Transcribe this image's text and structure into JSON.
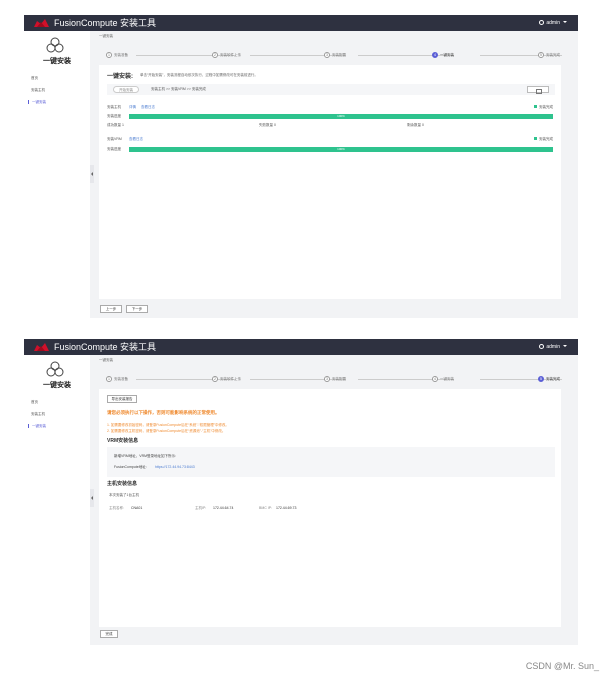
{
  "app": {
    "title": "FusionCompute 安装工具",
    "user": "admin"
  },
  "sidebar": {
    "title": "一键安装",
    "items": [
      {
        "label": "首页"
      },
      {
        "label": "安装主机"
      },
      {
        "label": "一键安装"
      }
    ]
  },
  "breadcrumb": "一键安装",
  "screen1": {
    "steps": [
      {
        "num": "1",
        "label": "安装准备"
      },
      {
        "num": "2",
        "label": "安装软件上传"
      },
      {
        "num": "3",
        "label": "安装配置"
      },
      {
        "num": "4",
        "label": "一键安装"
      },
      {
        "num": "5",
        "label": "安装完成"
      }
    ],
    "current_step": 3,
    "intro": {
      "title": "一键安装:",
      "description": "单击“开始安装”，安装流程自动依次执行，过程中如需修改可在安装前进行。"
    },
    "flow": {
      "tag": "开始安装",
      "text": "安装主机 >> 安装VRM >> 安装完成"
    },
    "host_section": {
      "label": "安装主机",
      "links": [
        "详情",
        "查看日志"
      ],
      "status": "安装完成",
      "progress_label": "安装进度",
      "progress": 100,
      "progress_text": "100%",
      "counts": [
        "成功数量 1",
        "失败数量 0",
        "剩余数量 0"
      ]
    },
    "vrm_section": {
      "label": "安装VRM",
      "links": [
        "查看日志"
      ],
      "status": "安装完成",
      "progress_label": "安装进度",
      "progress": 100,
      "progress_text": "100%"
    },
    "buttons": {
      "prev": "上一步",
      "next": "下一步"
    }
  },
  "screen2": {
    "steps": [
      {
        "num": "1",
        "label": "安装准备"
      },
      {
        "num": "2",
        "label": "安装软件上传"
      },
      {
        "num": "3",
        "label": "安装配置"
      },
      {
        "num": "4",
        "label": "一键安装"
      },
      {
        "num": "5",
        "label": "安装完成"
      }
    ],
    "current_step": 4,
    "export_button": "导出安装报告",
    "warning": {
      "title": "请您必须执行以下操作，否则可能影响系统的正常使用。",
      "lines": [
        "1. 如需要修改初始密码，请登录FusionCompute后在“系统”-“权限管理”中修改。",
        "2. 如需要修改主机密码，请登录FusionCompute后在“资源池”-“主机”中修改。"
      ]
    },
    "vrm_info": {
      "title": "VRM安装信息",
      "line1": "新增VRM地址，VRM登录地址如下所示:",
      "url_label": "FusionCompute地址:",
      "url": "https://172.44.94.73:8443"
    },
    "host_info": {
      "title": "主机安装信息",
      "line": "本次安装了1台主机",
      "row": [
        {
          "label": "主机名称:",
          "value": "CNA01"
        },
        {
          "label": "主机IP:",
          "value": "172.44.64.74"
        },
        {
          "label": "BMC IP:",
          "value": "172.44.69.73"
        }
      ]
    },
    "done_button": "完成"
  },
  "watermark": "CSDN @Mr. Sun_"
}
